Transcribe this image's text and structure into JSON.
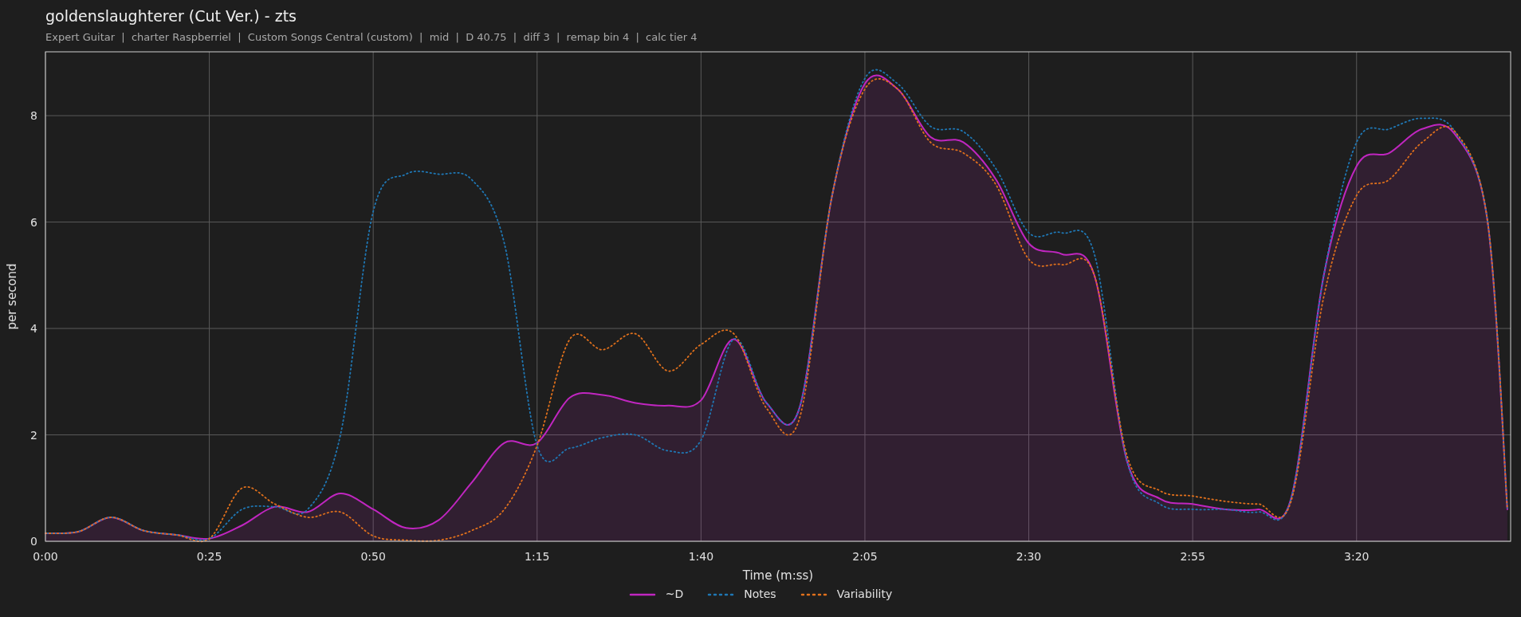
{
  "title": "goldenslaughterer (Cut Ver.) - zts",
  "subtitle": "Expert Guitar  |  charter Raspberriel  |  Custom Songs Central (custom)  |  mid  |  D 40.75  |  diff 3  |  remap bin 4  |  calc tier 4",
  "chart_data": {
    "type": "line",
    "xlabel": "Time (m:ss)",
    "ylabel": "per second",
    "x": [
      0,
      5,
      10,
      15,
      20,
      25,
      30,
      35,
      40,
      45,
      50,
      55,
      60,
      65,
      70,
      75,
      80,
      85,
      90,
      95,
      100,
      105,
      110,
      115,
      120,
      125,
      130,
      135,
      140,
      145,
      150,
      155,
      160,
      165,
      170,
      175,
      180,
      185,
      190,
      195,
      200,
      205,
      210,
      215,
      220,
      223
    ],
    "series": [
      {
        "name": "~D",
        "type": "area",
        "color": "#c026c0",
        "line_style": "solid",
        "values": [
          0.15,
          0.18,
          0.45,
          0.2,
          0.12,
          0.05,
          0.3,
          0.65,
          0.55,
          0.9,
          0.6,
          0.25,
          0.4,
          1.1,
          1.85,
          1.85,
          2.7,
          2.75,
          2.6,
          2.55,
          2.65,
          3.8,
          2.6,
          2.5,
          6.5,
          8.6,
          8.5,
          7.6,
          7.5,
          6.8,
          5.6,
          5.4,
          5.0,
          1.5,
          0.8,
          0.7,
          0.6,
          0.6,
          0.8,
          5.0,
          7.05,
          7.3,
          7.75,
          7.65,
          6.0,
          0.6
        ]
      },
      {
        "name": "Notes",
        "type": "line",
        "color": "#1f77b4",
        "line_style": "dotted",
        "values": [
          0.15,
          0.18,
          0.45,
          0.2,
          0.12,
          0.05,
          0.6,
          0.65,
          0.6,
          2.0,
          6.2,
          6.9,
          6.9,
          6.8,
          5.6,
          1.8,
          1.75,
          1.95,
          2.0,
          1.7,
          1.9,
          3.8,
          2.6,
          2.5,
          6.5,
          8.7,
          8.6,
          7.8,
          7.7,
          7.0,
          5.8,
          5.8,
          5.4,
          1.5,
          0.7,
          0.6,
          0.6,
          0.55,
          0.8,
          5.0,
          7.5,
          7.75,
          7.95,
          7.7,
          6.0,
          0.6
        ]
      },
      {
        "name": "Variability",
        "type": "line",
        "color": "#e0701c",
        "line_style": "dotted",
        "values": [
          0.15,
          0.18,
          0.45,
          0.2,
          0.12,
          0.05,
          1.0,
          0.7,
          0.45,
          0.55,
          0.1,
          0.02,
          0.02,
          0.2,
          0.6,
          1.8,
          3.8,
          3.6,
          3.9,
          3.2,
          3.7,
          3.9,
          2.5,
          2.3,
          6.5,
          8.5,
          8.5,
          7.5,
          7.3,
          6.7,
          5.3,
          5.2,
          5.0,
          1.6,
          0.95,
          0.85,
          0.75,
          0.7,
          0.75,
          4.6,
          6.5,
          6.8,
          7.5,
          7.7,
          6.0,
          0.6
        ]
      }
    ],
    "xlim": [
      0,
      223.5
    ],
    "ylim": [
      0,
      9.2
    ],
    "xticks": [
      {
        "value": 0,
        "label": "0:00"
      },
      {
        "value": 25,
        "label": "0:25"
      },
      {
        "value": 50,
        "label": "0:50"
      },
      {
        "value": 75,
        "label": "1:15"
      },
      {
        "value": 100,
        "label": "1:40"
      },
      {
        "value": 125,
        "label": "2:05"
      },
      {
        "value": 150,
        "label": "2:30"
      },
      {
        "value": 175,
        "label": "2:55"
      },
      {
        "value": 200,
        "label": "3:20"
      }
    ],
    "yticks": [
      0,
      2,
      4,
      6,
      8
    ],
    "grid": true,
    "legend": true
  }
}
